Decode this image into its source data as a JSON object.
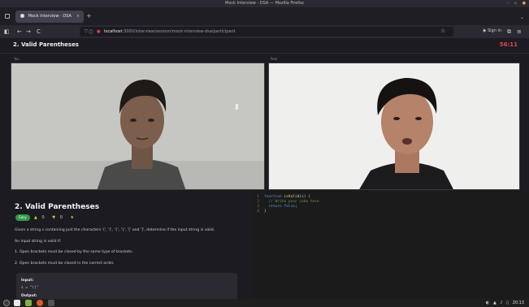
{
  "window": {
    "title": "Mock Interview - DSA — Mozilla Firefox"
  },
  "tab": {
    "label": "Mock Interview - DSA",
    "close": "×",
    "new": "+"
  },
  "nav": {
    "back": "←",
    "forward": "→",
    "reload": "C",
    "url_scheme": "localhost",
    "url_rest": ":3000/interview/session/mock-interview-dsa/participant"
  },
  "toolbar": {
    "signin": "Sign in",
    "bookmark": "☆",
    "menu": "≡"
  },
  "header": {
    "title": "2. Valid Parentheses",
    "timer": "56:11"
  },
  "videos": {
    "left_label": "You",
    "right_label": "Peer"
  },
  "problem": {
    "title": "2. Valid Parentheses",
    "difficulty": "Easy",
    "likes": "0",
    "dislikes": "0",
    "lines": [
      "Given a string s containing just the characters '(', ')', '{', '}', '[' and ']', determine if the input string is valid.",
      "An input string is valid if:",
      "1. Open brackets must be closed by the same type of brackets.",
      "2. Open brackets must be closed in the correct order."
    ],
    "example": {
      "input_label": "Input:",
      "input_value": "s = \"()\"",
      "output_label": "Output:"
    }
  },
  "editor": {
    "lines": [
      {
        "n": "1",
        "parts": [
          [
            "kw",
            "function "
          ],
          [
            "fn",
            "isValid"
          ],
          [
            "pl",
            "(s) {"
          ]
        ]
      },
      {
        "n": "2",
        "parts": [
          [
            "cm",
            "  // Write your code here"
          ]
        ]
      },
      {
        "n": "3",
        "parts": [
          [
            "kw",
            "  return "
          ],
          [
            "kw",
            "false"
          ],
          [
            "pl",
            ";"
          ]
        ]
      },
      {
        "n": "4",
        "parts": [
          [
            "pl",
            "}"
          ]
        ]
      }
    ]
  },
  "taskbar": {
    "time": "20:13"
  }
}
